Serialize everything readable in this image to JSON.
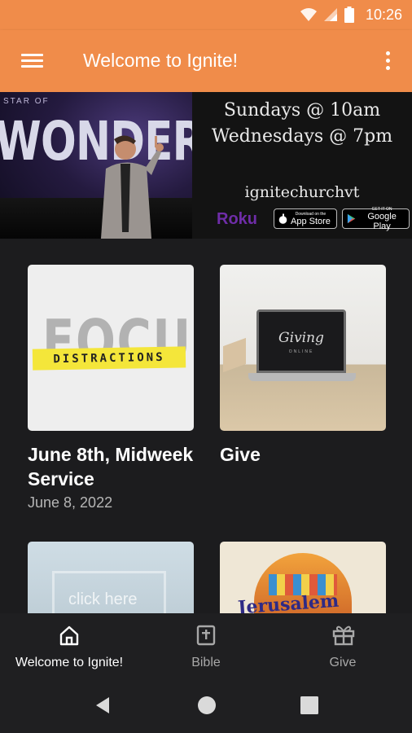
{
  "status_bar": {
    "time": "10:26",
    "icons": [
      "wifi-icon",
      "signal-icon",
      "battery-icon"
    ]
  },
  "app_bar": {
    "title": "Welcome to Ignite!",
    "menu_icon": "hamburger-menu-icon",
    "overflow_icon": "more-vert-icon"
  },
  "banner": {
    "series_small": "STAR OF",
    "series_title": "WONDER",
    "schedule_line1": "Sundays @ 10am",
    "schedule_line2": "Wednesdays @ 7pm",
    "handle": "ignitechurchvt",
    "roku": "Roku",
    "app_store_small": "Download on the",
    "app_store_big": "App Store",
    "google_play_small": "GET IT ON",
    "google_play_big": "Google Play"
  },
  "cards": [
    {
      "title": "June 8th, Midweek Service",
      "date": "June 8, 2022",
      "image_word": "FOCUS",
      "image_tape": "DISTRACTIONS"
    },
    {
      "title": "Give",
      "date": "",
      "image_script": "Giving",
      "image_sub": "ONLINE"
    },
    {
      "title": "",
      "date": "",
      "image_text": "click here"
    },
    {
      "title": "",
      "date": "",
      "image_text": "Jerusalem"
    }
  ],
  "bottom_nav": {
    "items": [
      {
        "label": "Welcome to Ignite!",
        "icon": "home-icon",
        "active": true
      },
      {
        "label": "Bible",
        "icon": "bible-icon",
        "active": false
      },
      {
        "label": "Give",
        "icon": "gift-icon",
        "active": false
      }
    ]
  },
  "colors": {
    "accent": "#f08c4a",
    "background": "#1c1c1e",
    "nav_active": "#ffffff",
    "nav_inactive": "#a8a8a8"
  }
}
